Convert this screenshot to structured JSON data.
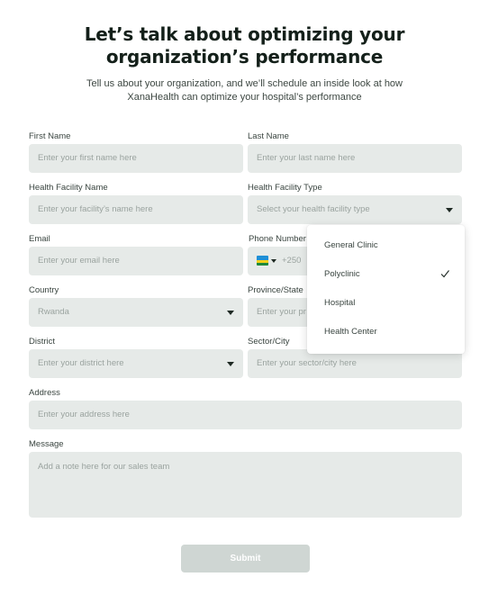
{
  "header": {
    "title_line1": "Let’s talk about optimizing your",
    "title_line2": "organization’s performance",
    "subtitle_line1": "Tell us about your organization, and we’ll schedule an inside look at how",
    "subtitle_line2": "XanaHealth can optimize your hospital’s performance"
  },
  "form": {
    "first_name": {
      "label": "First Name",
      "placeholder": "Enter your first name here"
    },
    "last_name": {
      "label": "Last Name",
      "placeholder": "Enter your last name here"
    },
    "facility_name": {
      "label": "Health Facility Name",
      "placeholder": "Enter your facility’s name here"
    },
    "facility_type": {
      "label": "Health Facility Type",
      "placeholder": "Select your health facility type"
    },
    "email": {
      "label": "Email",
      "placeholder": "Enter your email here"
    },
    "phone": {
      "label": "Phone Number",
      "dial_code": "+250",
      "flag_icon": "rwanda-flag-icon"
    },
    "country": {
      "label": "Country",
      "value": "Rwanda"
    },
    "province": {
      "label": "Province/State",
      "placeholder": "Enter your pr"
    },
    "district": {
      "label": "District",
      "placeholder": "Enter your district here"
    },
    "sector": {
      "label": "Sector/City",
      "placeholder": "Enter  your sector/city here"
    },
    "address": {
      "label": "Address",
      "placeholder": "Enter your address here"
    },
    "message": {
      "label": "Message",
      "placeholder": "Add a note here for our sales team"
    },
    "submit_label": "Submit"
  },
  "facility_type_dropdown": {
    "options": [
      "General Clinic",
      "Polyclinic",
      "Hospital",
      "Health Center"
    ],
    "selected": "Polyclinic"
  },
  "colors": {
    "field_bg": "#e6eae8",
    "submit_bg": "#cfd6d3",
    "title": "#14201a"
  }
}
